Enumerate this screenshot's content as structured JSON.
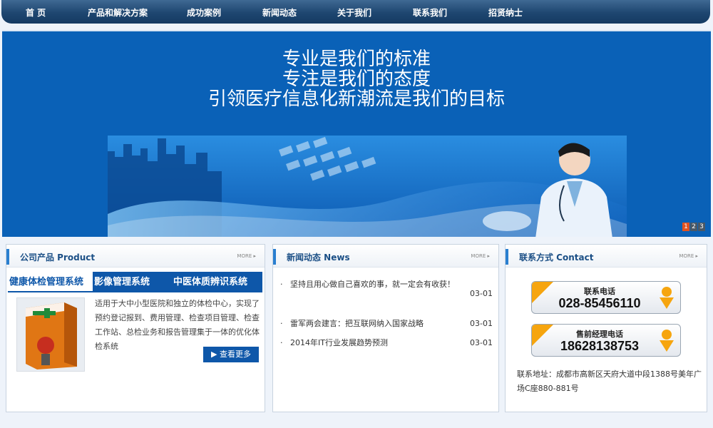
{
  "nav": {
    "items": [
      "首 页",
      "产品和解决方案",
      "成功案例",
      "新闻动态",
      "关于我们",
      "联系我们",
      "招贤纳士"
    ]
  },
  "banner": {
    "slogan_lines": [
      "专业是我们的标准",
      "专注是我们的态度",
      "引领医疗信息化新潮流是我们的目标"
    ],
    "slides": [
      "1",
      "2",
      "3"
    ]
  },
  "product": {
    "title": "公司产品 Product",
    "more": "MORE ▸",
    "tabs": [
      "健康体检管理系统",
      "影像管理系统",
      "中医体质辨识系统"
    ],
    "description": "适用于大中小型医院和独立的体检中心，实现了预约登记报到、费用管理、检查项目管理、检查工作站、总检业务和报告管理集于一体的优化体检系统",
    "see_more": "查看更多"
  },
  "news": {
    "title": "新闻动态 News",
    "more": "MORE ▸",
    "items": [
      {
        "text": "坚持且用心做自己喜欢的事，就一定会有收获！",
        "date": "03-01"
      },
      {
        "text": "雷军两会建言：把互联网纳入国家战略",
        "date": "03-01"
      },
      {
        "text": "2014年IT行业发展趋势预测",
        "date": "03-01"
      }
    ]
  },
  "contact": {
    "title": "联系方式 Contact",
    "more": "MORE ▸",
    "phones": [
      {
        "label": "联系电话",
        "number": "028-85456110"
      },
      {
        "label": "售前经理电话",
        "number": "18628138753"
      }
    ],
    "address": "联系地址：成都市高新区天府大道中段1388号美年广场C座880-881号"
  },
  "colors": {
    "nav": "#1e4670",
    "banner": "#0a61b7",
    "accent": "#0e57a9",
    "phone_corner": "#f6a50f"
  }
}
